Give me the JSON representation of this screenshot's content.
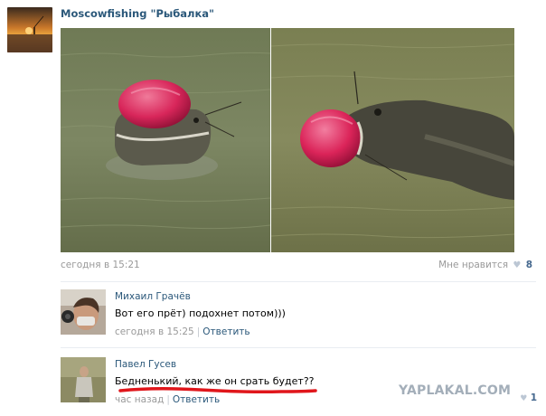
{
  "post": {
    "group_name": "Moscowfishing \"Рыбалка\"",
    "avatar_icon": "sunset-fishing-avatar",
    "photos": [
      "catfish-with-ball-photo",
      "catfish-with-ball-closeup-photo"
    ],
    "timestamp": "сегодня в 15:21",
    "like_label": "Мне нравится",
    "like_count": "8",
    "like_icon": "heart-icon"
  },
  "comments": [
    {
      "author": "Михаил Грачёв",
      "text": "Вот его прёт) подохнет потом)))",
      "timestamp": "сегодня в 15:25",
      "reply_label": "Ответить",
      "avatar_icon": "user-avatar"
    },
    {
      "author": "Павел Гусев",
      "text": "Бедненький, как же он срать будет??",
      "timestamp": "час назад",
      "reply_label": "Ответить",
      "like_count": "1",
      "avatar_icon": "user-avatar"
    }
  ],
  "watermark": "YAPLAKAL.COM",
  "colors": {
    "link": "#2b587a",
    "muted": "#999999",
    "underline": "#e0161b"
  }
}
